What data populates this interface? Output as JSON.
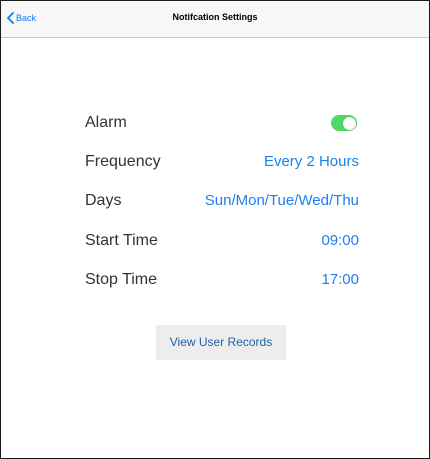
{
  "navbar": {
    "back_label": "Back",
    "title": "Notifcation Settings"
  },
  "settings": {
    "alarm": {
      "label": "Alarm",
      "enabled": true,
      "toggle_color": "#4cd964"
    },
    "frequency": {
      "label": "Frequency",
      "value": "Every 2 Hours"
    },
    "days": {
      "label": "Days",
      "value": "Sun/Mon/Tue/Wed/Thu"
    },
    "start_time": {
      "label": "Start Time",
      "value": "09:00"
    },
    "stop_time": {
      "label": "Stop Time",
      "value": "17:00"
    }
  },
  "actions": {
    "view_records_label": "View User Records"
  },
  "colors": {
    "accent": "#1a82f0",
    "toggle_on": "#4cd964"
  }
}
